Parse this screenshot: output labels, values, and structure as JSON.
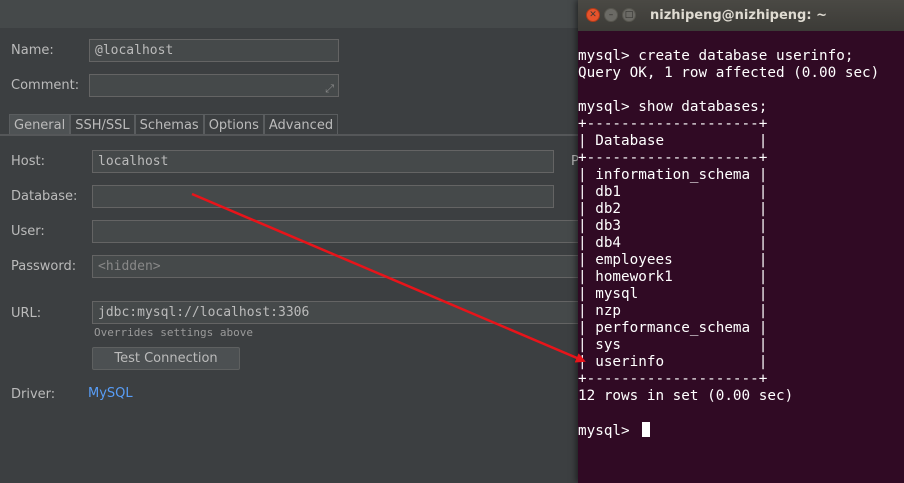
{
  "datasource": {
    "name_label": "Name:",
    "name_value": "@localhost",
    "comment_label": "Comment:",
    "comment_value": "",
    "tabs": [
      {
        "label": "General"
      },
      {
        "label": "SSH/SSL"
      },
      {
        "label": "Schemas"
      },
      {
        "label": "Options"
      },
      {
        "label": "Advanced"
      }
    ],
    "active_tab": "General",
    "host_label": "Host:",
    "host_value": "localhost",
    "host_side_label": "P",
    "database_label": "Database:",
    "database_value": "",
    "user_label": "User:",
    "user_value": "",
    "password_label": "Password:",
    "password_value": "<hidden>",
    "url_label": "URL:",
    "url_value": "jdbc:mysql://localhost:3306",
    "url_hint": "Overrides settings above",
    "test_button": "Test Connection",
    "driver_label": "Driver:",
    "driver_value": "MySQL"
  },
  "terminal": {
    "title": "nizhipeng@nizhipeng: ~",
    "lines": [
      "",
      "mysql> create database userinfo;",
      "Query OK, 1 row affected (0.00 sec)",
      "",
      "mysql> show databases;",
      "+--------------------+",
      "| Database           |",
      "+--------------------+",
      "| information_schema |",
      "| db1                |",
      "| db2                |",
      "| db3                |",
      "| db4                |",
      "| employees          |",
      "| homework1          |",
      "| mysql              |",
      "| nzp                |",
      "| performance_schema |",
      "| sys                |",
      "| userinfo           |",
      "+--------------------+",
      "12 rows in set (0.00 sec)",
      "",
      "mysql> "
    ]
  },
  "colors": {
    "panel_bg": "#3c3f41",
    "terminal_bg": "#300a24",
    "arrow": "#e8141a",
    "link": "#589df6"
  }
}
